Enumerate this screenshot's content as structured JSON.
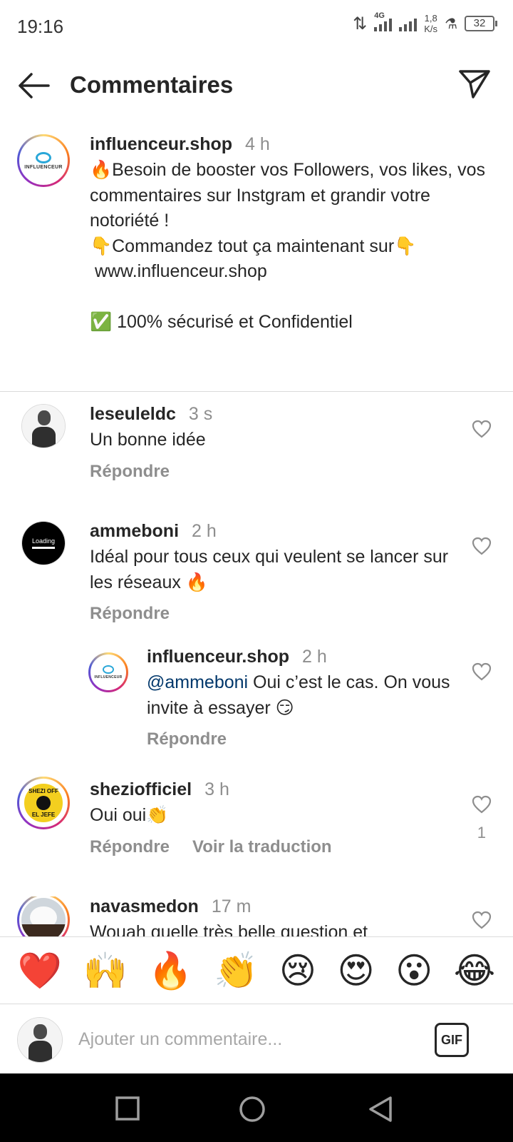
{
  "status_bar": {
    "time": "19:16",
    "network": "4G",
    "speed_value": "1,8",
    "speed_unit": "K/s",
    "battery": "32"
  },
  "header": {
    "title": "Commentaires"
  },
  "caption": {
    "username": "influenceur.shop",
    "time": "4 h",
    "text": "🔥Besoin de booster vos Followers, vos likes, vos commentaires sur Instgram et grandir votre notoriété !\n👇Commandez tout ça maintenant sur👇\n www.influenceur.shop\n\n✅ 100% sécurisé et Confidentiel",
    "avatar_logo_text": "INFLUENCEUR"
  },
  "comments": [
    {
      "username": "leseuleldc",
      "time": "3 s",
      "text": "Un bonne idée",
      "reply_label": "Répondre"
    },
    {
      "username": "ammeboni",
      "time": "2 h",
      "text": "Idéal pour tous ceux qui veulent se lancer sur les réseaux 🔥",
      "reply_label": "Répondre",
      "avatar_text": "Loading"
    },
    {
      "username": "influenceur.shop",
      "time": "2 h",
      "mention": "@ammeboni",
      "text": " Oui c’est le cas. On vous invite à essayer 😏",
      "reply_label": "Répondre",
      "avatar_logo_text": "INFLUENCEUR"
    },
    {
      "username": "sheziofficiel",
      "time": "3 h",
      "text": "Oui oui👏",
      "reply_label": "Répondre",
      "translate_label": "Voir la traduction",
      "like_count": "1",
      "avatar_text_top": "SHEZI OFF",
      "avatar_text_bottom": "EL JEFE"
    },
    {
      "username": "navasmedon",
      "time": "17 m",
      "text": "Wouah quelle très belle question et"
    }
  ],
  "emoji_bar": [
    "❤️",
    "🙌",
    "🔥",
    "👏",
    "😢",
    "😍",
    "😮",
    "😂"
  ],
  "input": {
    "placeholder": "Ajouter un commentaire...",
    "gif_label": "GIF"
  },
  "colors": {
    "text": "#262626",
    "secondary": "#8e8e8e",
    "mention": "#00376b",
    "divider": "#dbdbdb"
  }
}
